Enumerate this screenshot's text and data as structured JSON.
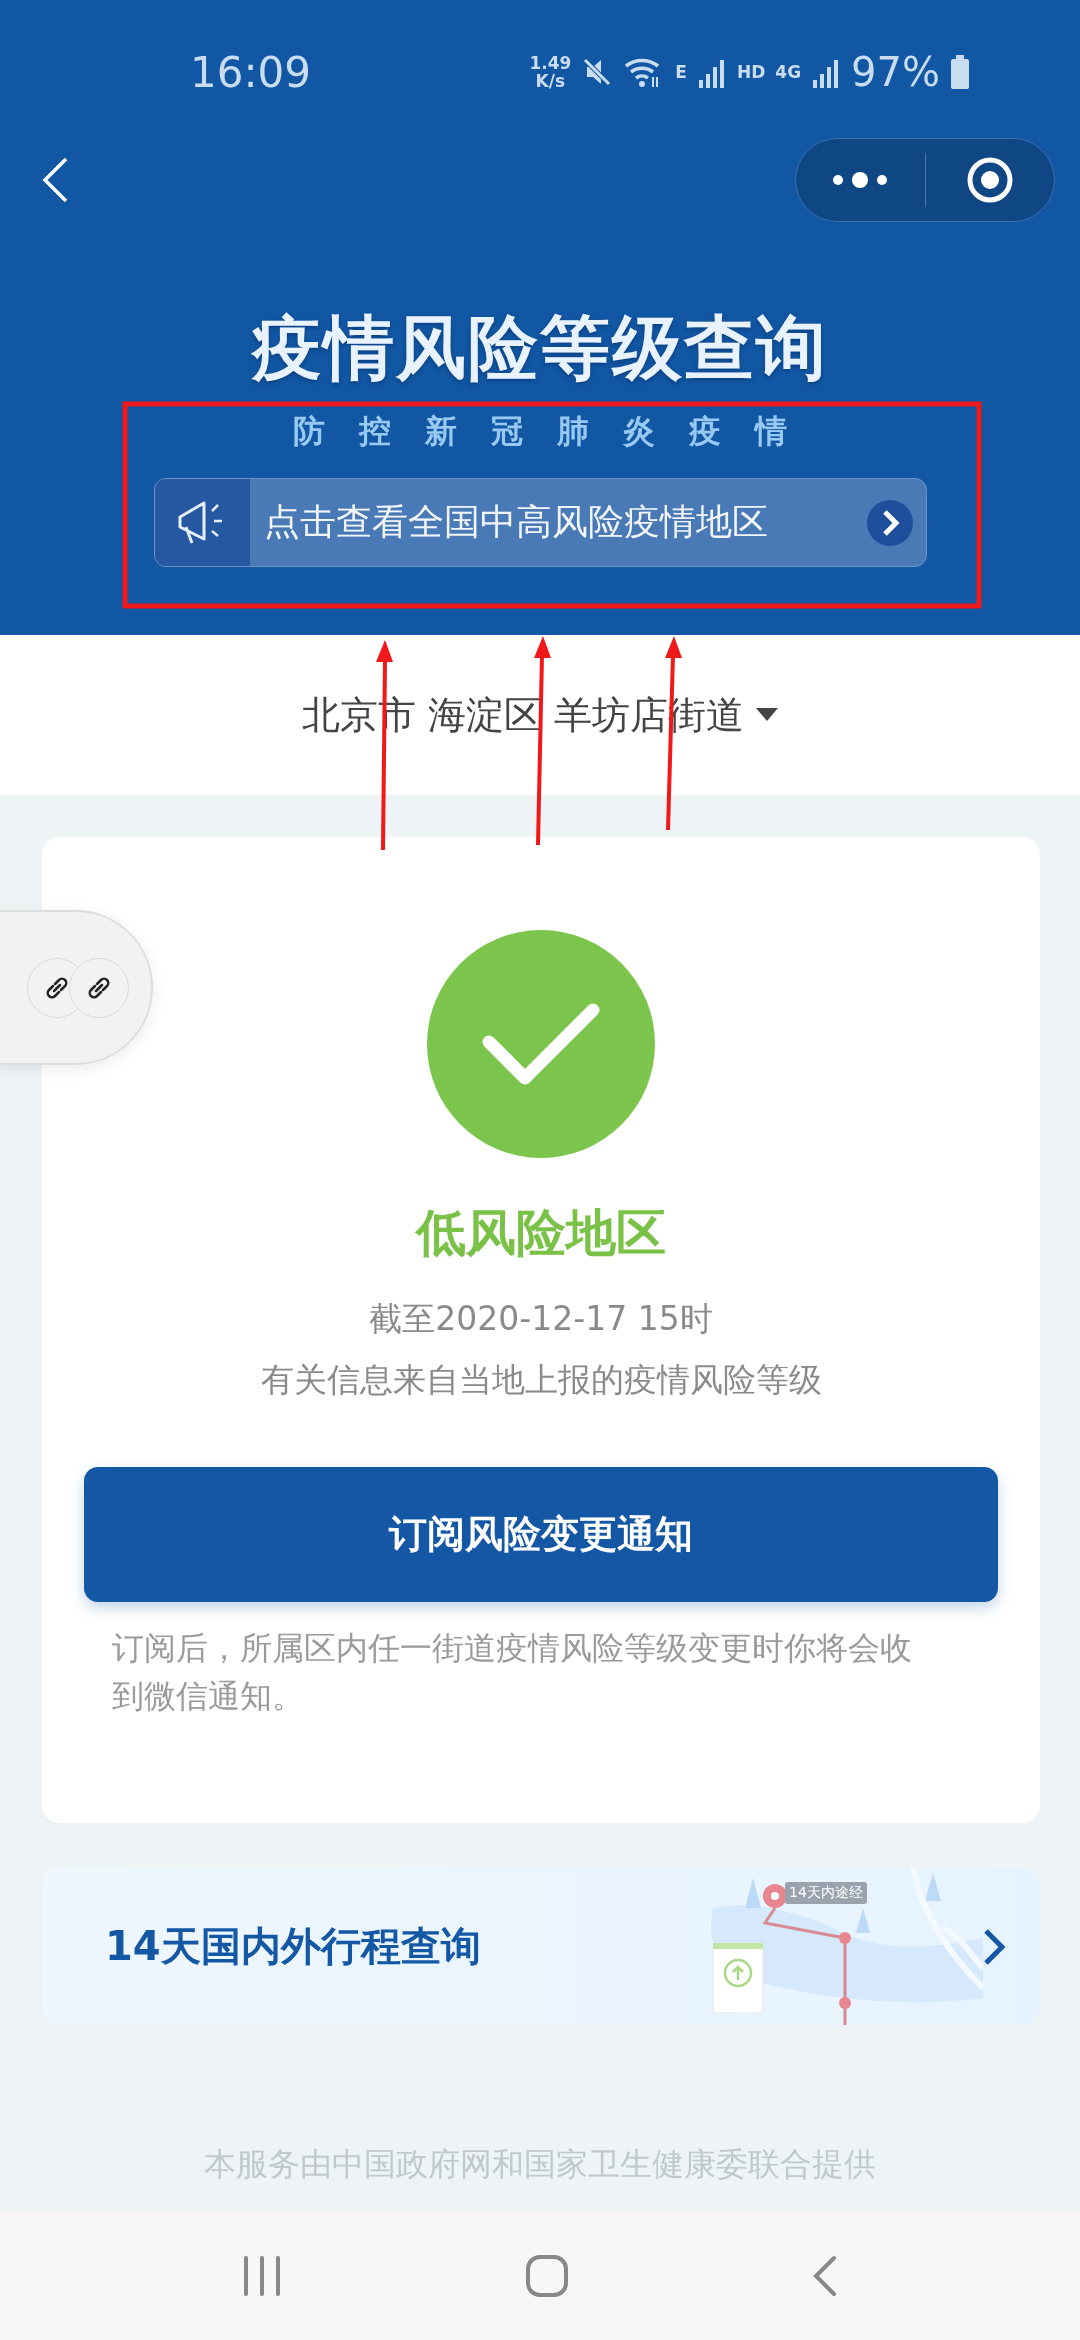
{
  "status_bar": {
    "time": "16:09",
    "speed_value": "1.49",
    "speed_unit": "K/s",
    "network_label": "E",
    "hd_label": "HD",
    "mobile_label": "4G",
    "battery": "97%"
  },
  "header": {
    "title": "疫情风险等级查询",
    "subtitle": "防控新冠肺炎疫情",
    "notice": "点击查看全国中高风险疫情地区"
  },
  "location": {
    "parts": [
      "北京市",
      "海淀区",
      "羊坊店街道"
    ]
  },
  "result": {
    "level_label": "低风险地区",
    "updated": "截至2020-12-17 15时",
    "source": "有关信息来自当地上报的疫情风险等级",
    "subscribe_button": "订阅风险变更通知",
    "subscribe_note": "订阅后，所属区内任一街道疫情风险等级变更时你将会收到微信通知。"
  },
  "trip_card": {
    "title": "14天国内外行程查询",
    "map_tag": "14天内途经"
  },
  "footer": "本服务由中国政府网和国家卫生健康委联合提供"
}
